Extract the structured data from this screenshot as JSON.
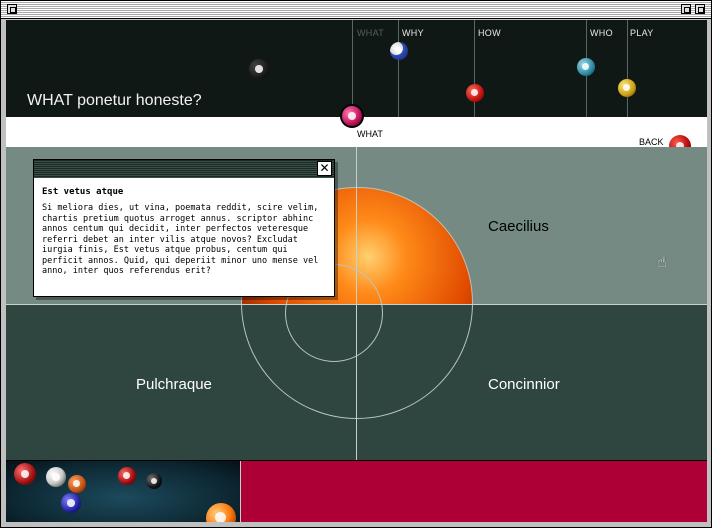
{
  "window": {
    "title": ""
  },
  "nav": {
    "items": [
      {
        "label": "WHAT",
        "active": true
      },
      {
        "label": "WHY",
        "active": false
      },
      {
        "label": "HOW",
        "active": false
      },
      {
        "label": "WHO",
        "active": false
      },
      {
        "label": "PLAY",
        "active": false
      }
    ],
    "current_label": "WHAT",
    "back_label": "BACK"
  },
  "page": {
    "title": "WHAT ponetur honeste?"
  },
  "quadrants": {
    "top_right": "Caecilius",
    "bottom_left": "Pulchraque",
    "bottom_right": "Concinnior"
  },
  "popup": {
    "title": "Est vetus atque",
    "body": "Si meliora dies, ut vina, poemata reddit, scire velim, chartis pretium quotus arroget annus. scriptor abhinc annos centum qui decidit, inter perfectos veteresque referri debet an inter vilis atque novos? Excludat iurgia finis, Est vetus atque probus, centum qui perficit annos. Quid, qui deperiit minor uno mense vel anno, inter quos referendus erit?",
    "close_icon": "close-icon"
  },
  "colors": {
    "header_bg": "#101815",
    "panel_light": "#758a82",
    "panel_dark": "#2f453f",
    "accent": "#ad0036"
  }
}
